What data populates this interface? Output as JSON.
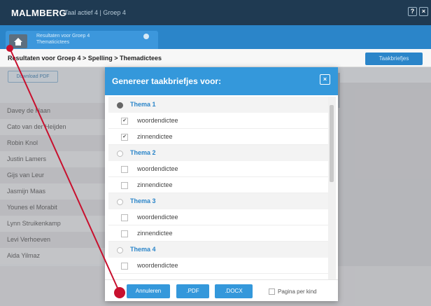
{
  "topbar": {
    "logo": "MALMBERG",
    "breadcrumb": "Taal actief 4  |  Groep 4",
    "help_label": "?",
    "close_label": "×"
  },
  "tab": {
    "label": "Resultaten voor Groep 4 Thematicictees"
  },
  "page": {
    "title": "Resultaten voor Groep 4 > Spelling > Themadictees",
    "taakbriefjes_label": "Taakbriefjes",
    "download_label": "Download PDF"
  },
  "students": [
    "Davey de Haan",
    "Cato van der Heijden",
    "Robin Knol",
    "Justin Lamers",
    "Gijs van Leur",
    "Jasmijn Maas",
    "Younes el Morabit",
    "Lynn Struikenkamp",
    "Levi Verhoeven",
    "Aida Yilmaz"
  ],
  "modal": {
    "title": "Genereer taakbriefjes voor:",
    "close_label": "×",
    "rows": [
      {
        "type": "theme",
        "label": "Thema 1",
        "selected": true
      },
      {
        "type": "item",
        "label": "woordendictee",
        "checked": true
      },
      {
        "type": "item",
        "label": "zinnendictee",
        "checked": true
      },
      {
        "type": "theme",
        "label": "Thema 2",
        "selected": false
      },
      {
        "type": "item",
        "label": "woordendictee",
        "checked": false
      },
      {
        "type": "item",
        "label": "zinnendictee",
        "checked": false
      },
      {
        "type": "theme",
        "label": "Thema 3",
        "selected": false
      },
      {
        "type": "item",
        "label": "woordendictee",
        "checked": false
      },
      {
        "type": "item",
        "label": "zinnendictee",
        "checked": false
      },
      {
        "type": "theme",
        "label": "Thema 4",
        "selected": false
      },
      {
        "type": "item",
        "label": "woordendictee",
        "checked": false
      }
    ],
    "cancel_label": "Annuleren",
    "pdf_label": ".PDF",
    "docx_label": ".DOCX",
    "per_child_label": "Pagina per kind"
  },
  "colors": {
    "accent": "#3498db",
    "topbar": "#1f3a52",
    "pointer": "#c8102e"
  }
}
